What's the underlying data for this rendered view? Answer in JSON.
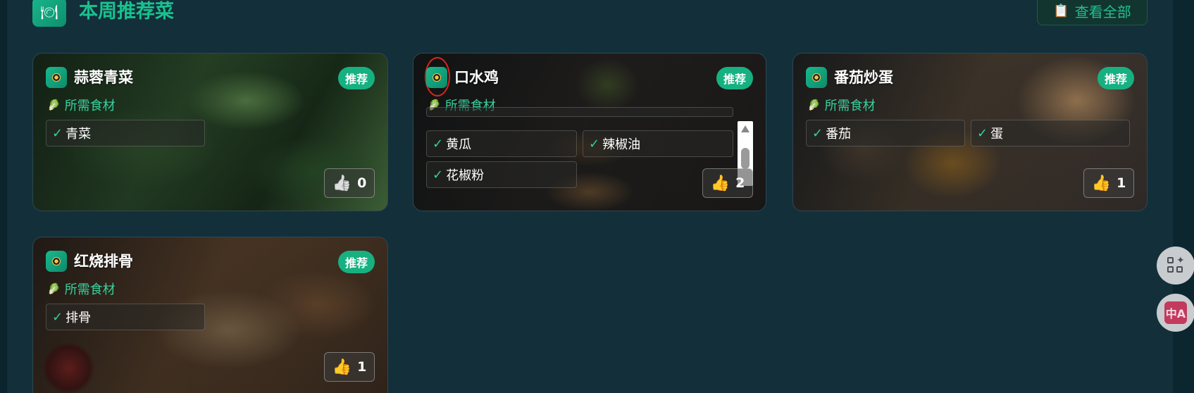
{
  "header": {
    "title": "本周推荐菜",
    "header_icon": "plate-icon",
    "view_all_label": "查看全部",
    "view_all_icon": "clipboard-icon"
  },
  "colors": {
    "accent": "#19c18e",
    "badge": "#17b181",
    "background": "#132f3a"
  },
  "dishes": [
    {
      "name": "蒜蓉青菜",
      "badge": "推荐",
      "ingredients_label": "所需食材",
      "ingredients": [
        "青菜"
      ],
      "likes": "0"
    },
    {
      "name": "口水鸡",
      "badge": "推荐",
      "ingredients_label": "所需食材",
      "ingredients": [
        "黄瓜",
        "辣椒油",
        "花椒粉"
      ],
      "likes": "2"
    },
    {
      "name": "番茄炒蛋",
      "badge": "推荐",
      "ingredients_label": "所需食材",
      "ingredients": [
        "番茄",
        "蛋"
      ],
      "likes": "1"
    },
    {
      "name": "红烧排骨",
      "badge": "推荐",
      "ingredients_label": "所需食材",
      "ingredients": [
        "排骨"
      ],
      "likes": "1"
    }
  ],
  "check_mark": "✓",
  "floating": {
    "apps_icon": "apps-sparkle-icon",
    "translate_icon": "translate-icon",
    "translate_text": "中A"
  }
}
